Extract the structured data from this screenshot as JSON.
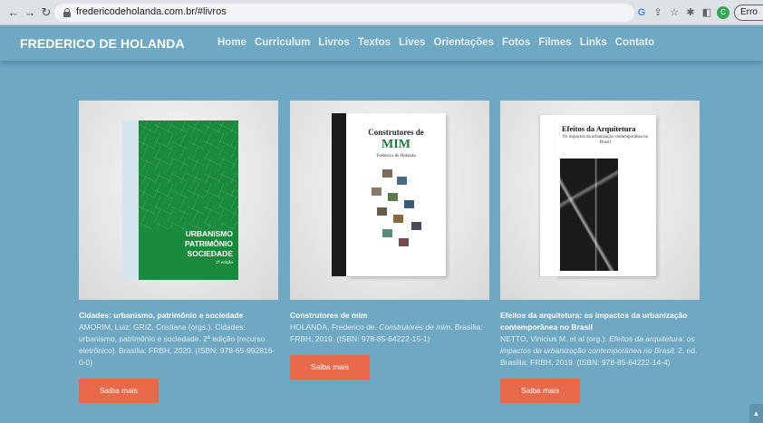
{
  "browser": {
    "url": "fredericodeholanda.com.br/#livros",
    "profile_initial": "C",
    "error_label": "Erro"
  },
  "header": {
    "brand": "FREDERICO DE HOLANDA",
    "menu": [
      "Home",
      "Curriculum",
      "Livros",
      "Textos",
      "Lives",
      "Orientações",
      "Fotos",
      "Filmes",
      "Links",
      "Contato"
    ]
  },
  "books": [
    {
      "cover_title_lines": [
        "URBANISMO",
        "PATRIMÔNIO",
        "SOCIEDADE"
      ],
      "cover_edition": "2ª edição",
      "title": "Cidades: urbanismo, patrimônio e sociedade",
      "ref": "AMORIM, Luiz; GRIZ, Cristiana (orgs.). Cidades: urbanismo, patrimônio e sociedade. 2ª edição [recurso eletrônico]. Brasília: FRBH, 2020. (ISBN: 978-65-992816-0-0)",
      "button": "Saiba mais"
    },
    {
      "cover_title_a": "Construtores de",
      "cover_title_b": "MIM",
      "cover_author": "Frederico de Holanda",
      "title": "Construtores de mim",
      "ref_pre": "HOLANDA, Frederico de. ",
      "ref_italic": "Construtores de mim",
      "ref_post": ". Brasília: FRBH, 2019. (ISBN: 978-85-64222-15-1)",
      "button": "Saiba mais"
    },
    {
      "cover_title_a": "Efeitos da Arquitetura",
      "cover_title_b": "Os impactos da urbanização contemporânea no Brasil",
      "title": "Efeitos da arquitetura: os impactos da urbanização contemporânea no Brasil",
      "ref_pre": "NETTO, Vinicius M. et al (org.). ",
      "ref_italic": "Efeitos da arquitetura: os impactos da urbanização contemporânea no Brasil",
      "ref_post": ". 2. ed. Brasília: FRBH, 2019. (ISBN: 978-85-64222-14-4)",
      "button": "Saiba mais"
    }
  ]
}
